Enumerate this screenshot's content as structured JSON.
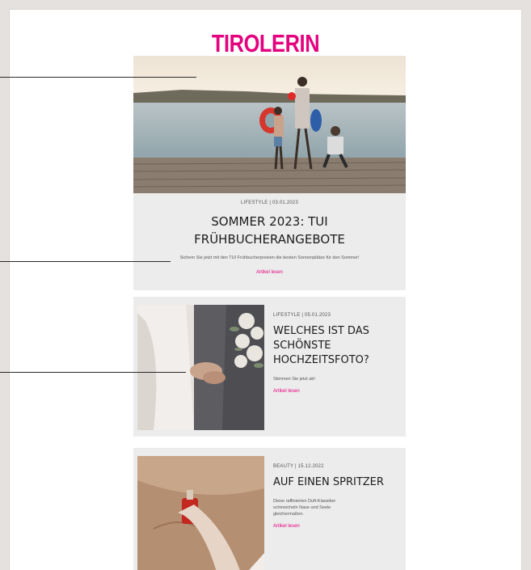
{
  "brand": {
    "logo_text": "TIROLERIN",
    "accent": "#e5007e"
  },
  "hero": {
    "meta": "LIFESTYLE | 03.01.2023",
    "title_line1": "SOMMER 2023: TUI",
    "title_line2": "FRÜHBUCHERANGEBOTE",
    "teaser": "Sichern Sie jetzt mit den TUI Frühbucherpreisen die besten Sonnenplätze für den Sommer!",
    "link": "Artikel lesen"
  },
  "articles": [
    {
      "meta": "LIFESTYLE | 05.01.2023",
      "title_line1": "WELCHES IST DAS",
      "title_line2": "SCHÖNSTE",
      "title_line3": "HOCHZEITSFOTO?",
      "teaser": "Stimmen Sie jetzt ab!",
      "link": "Artikel lesen"
    },
    {
      "meta": "BEAUTY | 15.12.2022",
      "title_line1": "AUF EINEN SPRITZER",
      "teaser_line1": "Diese raffinierten Duft-Klassiker",
      "teaser_line2": "schmeicheln Nase und Seele",
      "teaser_line3": "gleichermaßen.",
      "link": "Artikel lesen"
    }
  ]
}
